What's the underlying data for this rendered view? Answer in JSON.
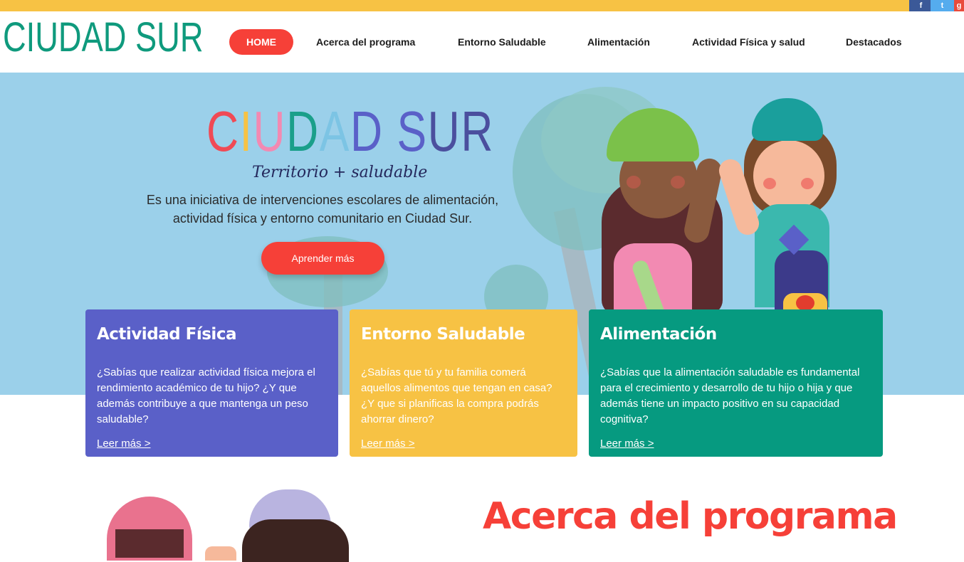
{
  "social": {
    "facebook_icon": "f",
    "twitter_icon": "t",
    "other_icon": "g"
  },
  "header": {
    "logo": "CIUDAD SUR",
    "nav": [
      "HOME",
      "Acerca del programa",
      "Entorno Saludable",
      "Alimentación",
      "Actividad Física y salud",
      "Destacados"
    ]
  },
  "hero": {
    "title_letters": [
      "C",
      "I",
      "U",
      "D",
      "A",
      "D",
      " ",
      "S",
      "U",
      "R"
    ],
    "title_colors": [
      "#f04a55",
      "#f7c244",
      "#f28ab2",
      "#1a9f8a",
      "#7cc4e4",
      "#5a60c8",
      "#ffffff",
      "#5a60c8",
      "#4b4f9e",
      "#4b4f9e"
    ],
    "subtitle": "Territorio + saludable",
    "description": "Es una iniciativa de intervenciones escolares de alimentación, actividad física y entorno comunitario en Ciudad Sur.",
    "button": "Aprender más"
  },
  "cards": [
    {
      "title": "Actividad Física",
      "text": "¿Sabías que realizar actividad física mejora el rendimiento académico de tu hijo? ¿Y que además contribuye a que mantenga un peso saludable?",
      "link": "Leer más >"
    },
    {
      "title": "Entorno Saludable",
      "text": "¿Sabías que tú y tu familia comerá aquellos alimentos que tengan en casa? ¿Y que si planificas la compra podrás ahorrar dinero?",
      "link": "Leer más >"
    },
    {
      "title": "Alimentación",
      "text": "¿Sabías que la alimentación saludable es fundamental para el crecimiento y desarrollo de tu hijo o hija y que además tiene un impacto positivo en su capacidad cognitiva?",
      "link": "Leer más >"
    }
  ],
  "about": {
    "title": "Acerca del programa"
  },
  "colors": {
    "accent": "#f64038",
    "yellow": "#f7c244",
    "green": "#069a80",
    "purple": "#5a60c8",
    "sky": "#9bd0ea"
  }
}
